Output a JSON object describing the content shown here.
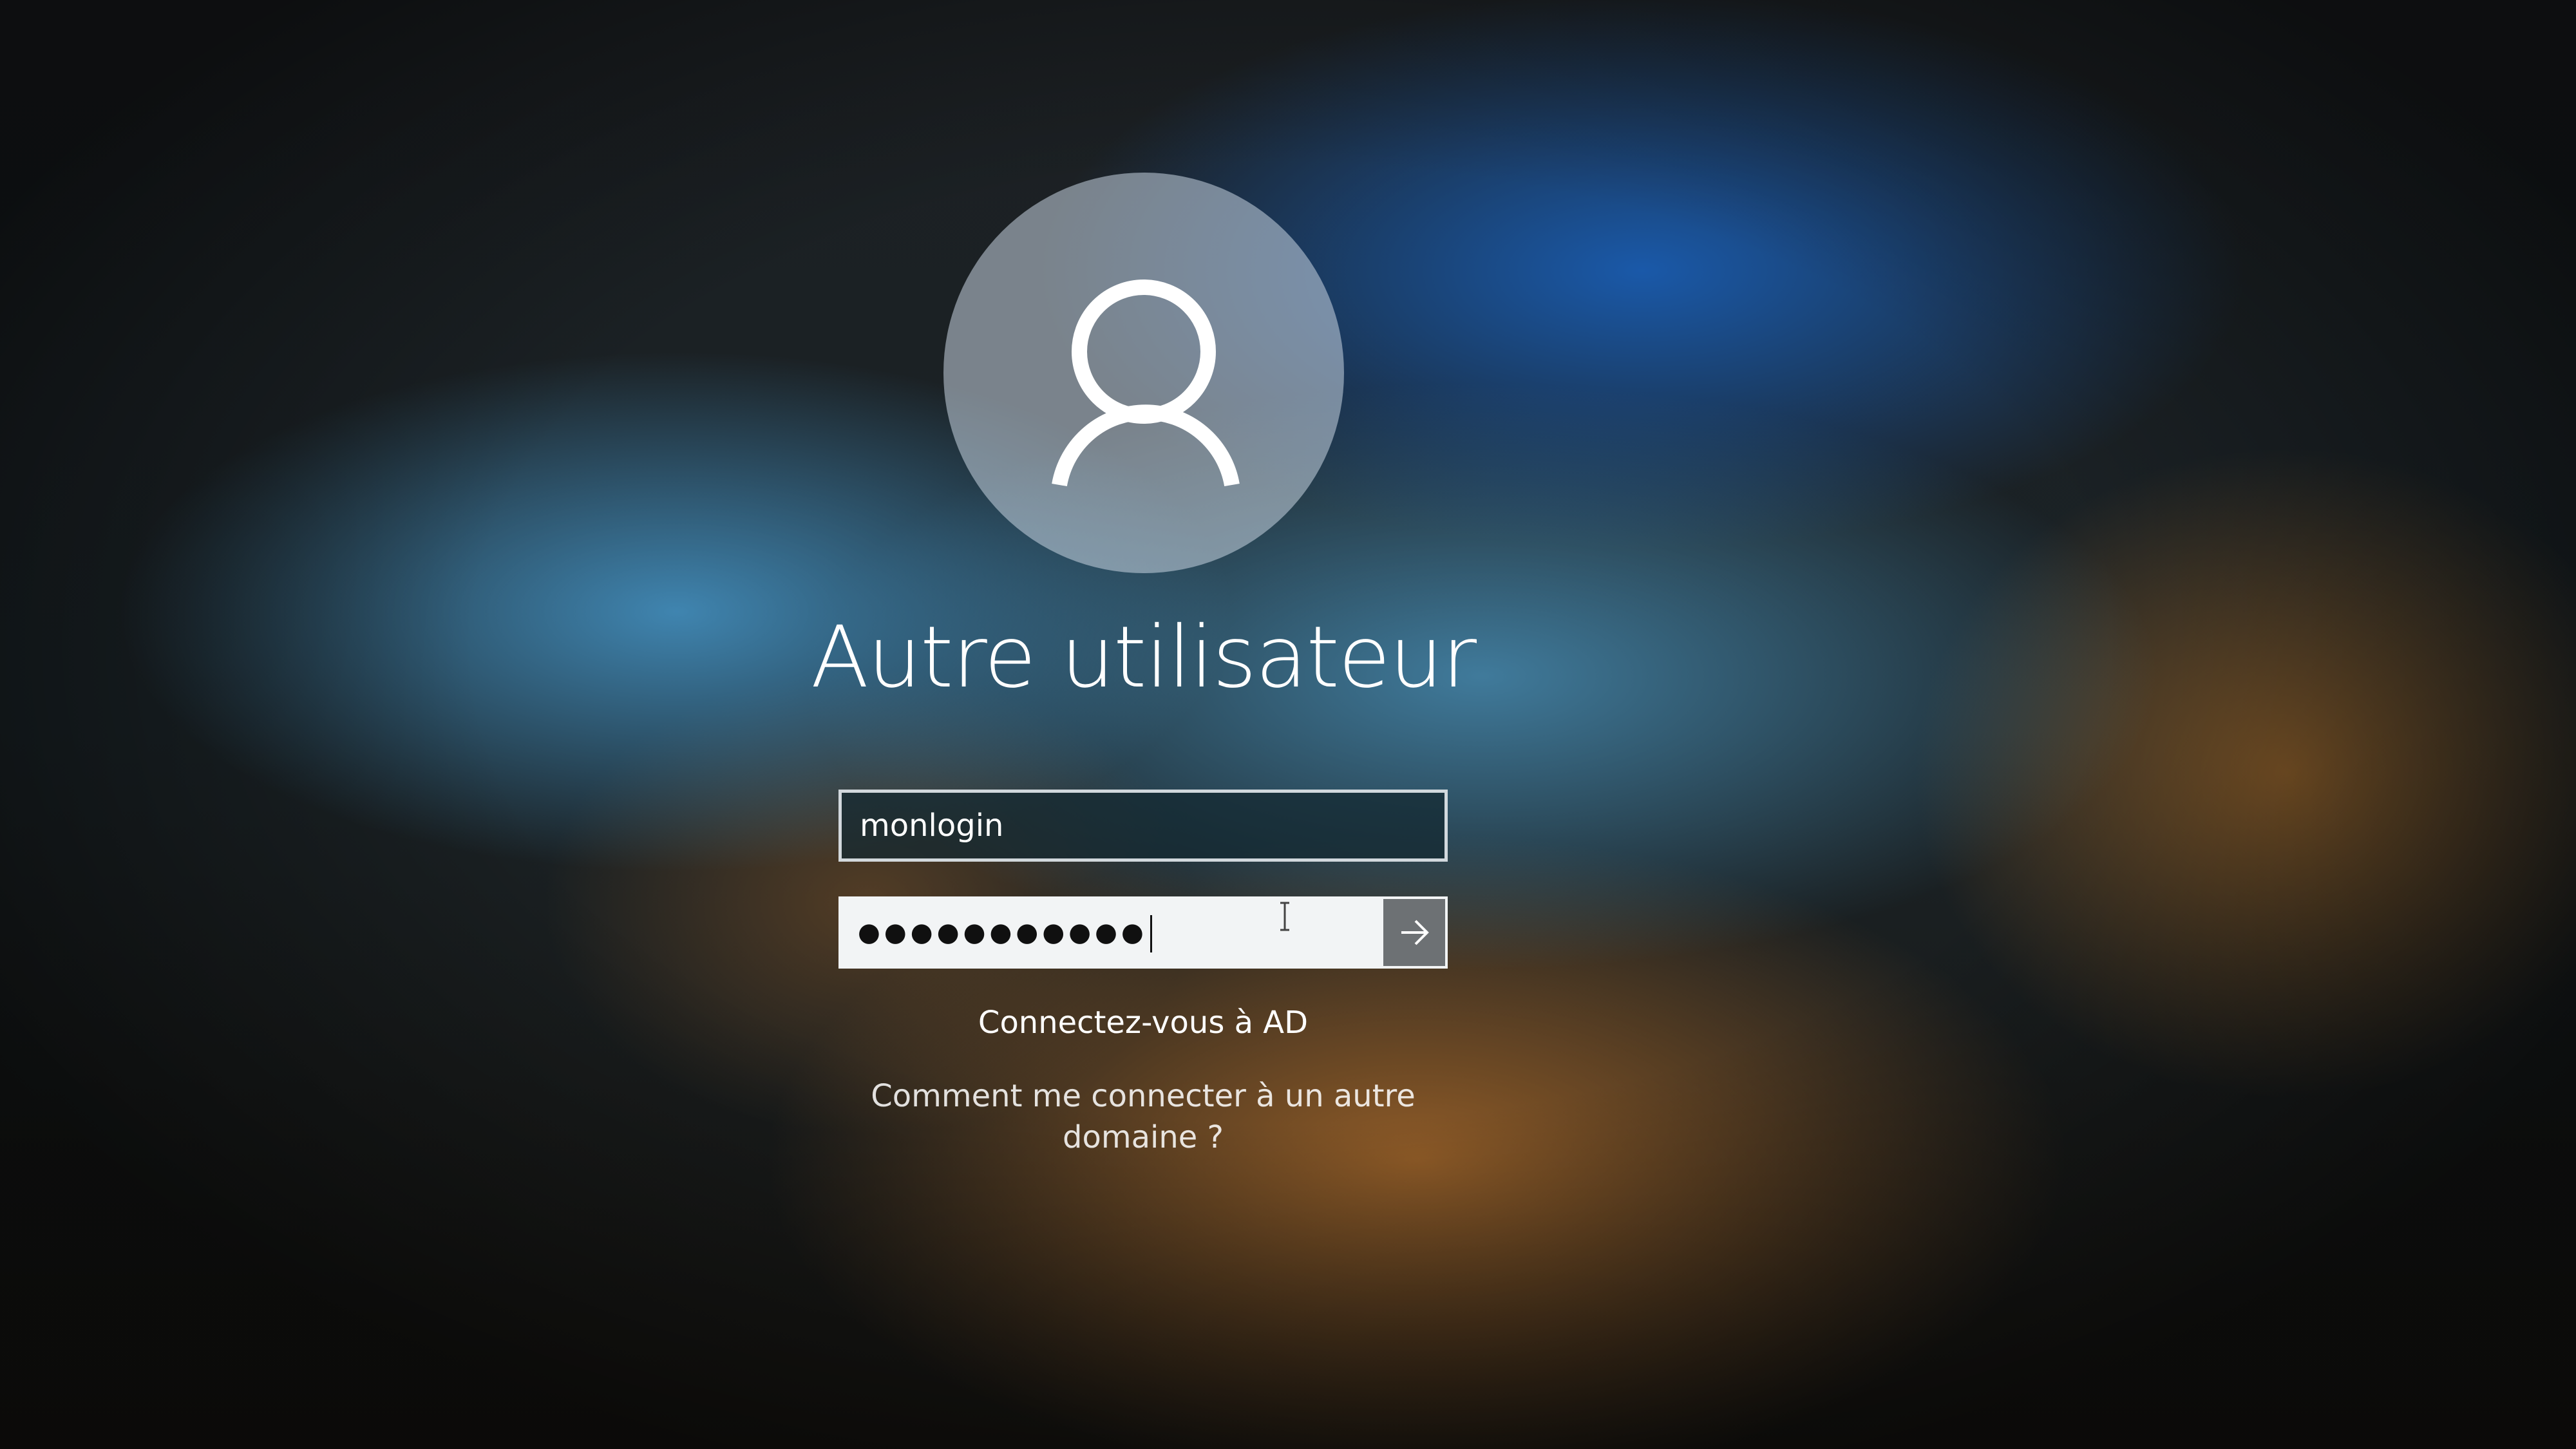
{
  "login": {
    "avatar_icon": "user-icon",
    "user_name": "Autre utilisateur",
    "username_value": "monlogin",
    "password_masked": "●●●●●●●●●●●",
    "submit_icon": "arrow-right-icon",
    "sign_in_to": "Connectez-vous à AD",
    "other_domain_line1": "Comment me connecter à un autre",
    "other_domain_line2": "domaine ?"
  },
  "colors": {
    "accent_blue": "#1a5cb0",
    "warm_brown": "#965f28",
    "input_light": "#f2f4f5",
    "submit_gray": "#6d7174"
  }
}
